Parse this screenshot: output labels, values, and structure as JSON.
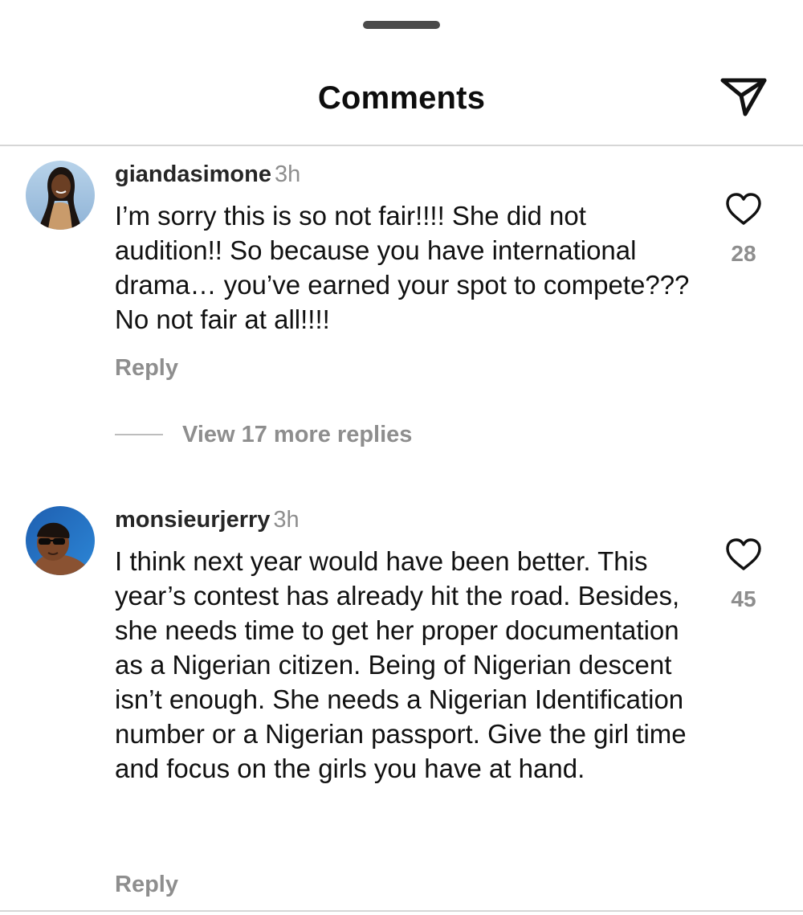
{
  "header": {
    "title": "Comments",
    "share_icon": "send-icon"
  },
  "comments": [
    {
      "username": "giandasimone",
      "time": "3h",
      "text": "I’m sorry this is so not fair!!!! She did not audition!! So because you have international drama… you’ve earned your spot to compete??? No not fair at all!!!!",
      "likes": "28",
      "reply_label": "Reply",
      "view_replies_label": "View 17 more replies"
    },
    {
      "username": "monsieurjerry",
      "time": "3h",
      "text": "I think next year would have been better. This year’s contest has already hit the road. Besides, she needs time to get her proper documentation as a Nigerian citizen. Being of Nigerian descent isn’t enough. She needs a Nigerian Identification number or a Nigerian passport. Give the girl time and focus on the girls you have at hand.",
      "likes": "45",
      "reply_label": "Reply"
    }
  ],
  "colors": {
    "primary_text": "#111111",
    "secondary_text": "#8e8e8e",
    "divider": "#d6d6d6",
    "background": "#ffffff"
  }
}
